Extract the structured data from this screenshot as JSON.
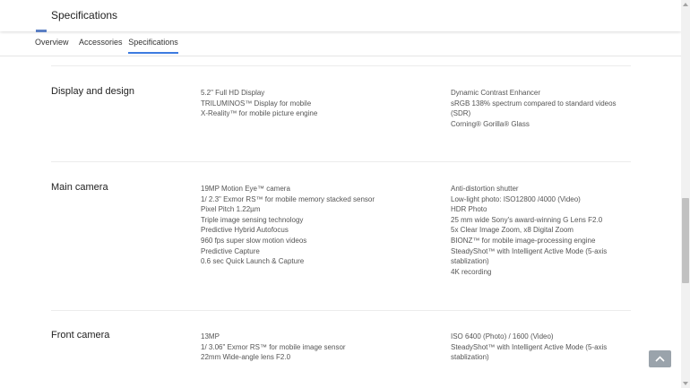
{
  "header": {
    "title": "Specifications"
  },
  "tabs": [
    {
      "label": "Overview"
    },
    {
      "label": "Accessories"
    },
    {
      "label": "Specifications",
      "active": true
    }
  ],
  "sections": [
    {
      "title": "Display and design",
      "left": [
        "5.2\" Full HD Display",
        "TRILUMINOS™ Display for mobile",
        "X-Reality™ for mobile picture engine"
      ],
      "right": [
        "Dynamic Contrast Enhancer",
        "sRGB 138% spectrum compared to standard videos",
        "(SDR)",
        "Corning® Gorilla® Glass"
      ]
    },
    {
      "title": "Main camera",
      "left": [
        "19MP Motion Eye™ camera",
        "1/ 2.3\" Exmor RS™ for mobile memory stacked sensor",
        "Pixel Pitch 1.22µm",
        "Triple image sensing technology",
        "Predictive Hybrid Autofocus",
        "960 fps super slow motion videos",
        "Predictive Capture",
        "0.6 sec Quick Launch & Capture"
      ],
      "right": [
        "Anti-distortion shutter",
        "Low-light photo: ISO12800 /4000 (Video)",
        "HDR Photo",
        "25 mm wide Sony's award-winning G Lens F2.0",
        "5x Clear Image Zoom, x8 Digital Zoom",
        "BIONZ™ for mobile image-processing engine",
        "SteadyShot™ with Intelligent Active Mode (5-axis",
        "stablization)",
        "4K recording"
      ]
    },
    {
      "title": "Front camera",
      "left": [
        "13MP",
        "1/ 3.06\"  Exmor RS™ for mobile image sensor",
        "22mm Wide-angle lens F2.0"
      ],
      "right": [
        "ISO 6400 (Photo) / 1600 (Video)",
        "SteadyShot™ with Intelligent Active Mode (5-axis",
        "stablization)"
      ]
    }
  ],
  "colors": {
    "accent": "#3d7be0",
    "back_to_top_bg": "#9aa3ab"
  },
  "icons": {
    "back_to_top": "chevron-up-icon"
  }
}
